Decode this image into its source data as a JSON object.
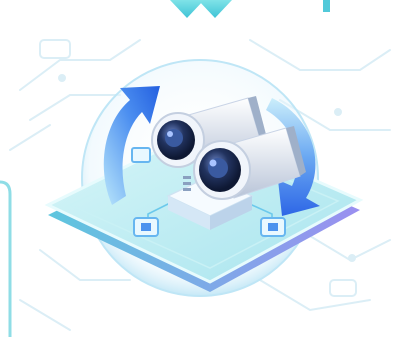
{
  "illustration": {
    "subject": "camera-rotation-illustration",
    "icons": [
      "security-camera-icon",
      "rotate-arrow-icon",
      "chip-icon"
    ],
    "colors": {
      "accent_blue": "#2f74e6",
      "arrow_light": "#8ad0f5",
      "platform_top": "#bfeef3",
      "platform_side": "#7ad6e6",
      "circuit_lines": "#d9edf5",
      "bubble": "#dff3fb",
      "camera_body": "#e6ebf3",
      "lens_dark": "#1d2a4f"
    }
  }
}
